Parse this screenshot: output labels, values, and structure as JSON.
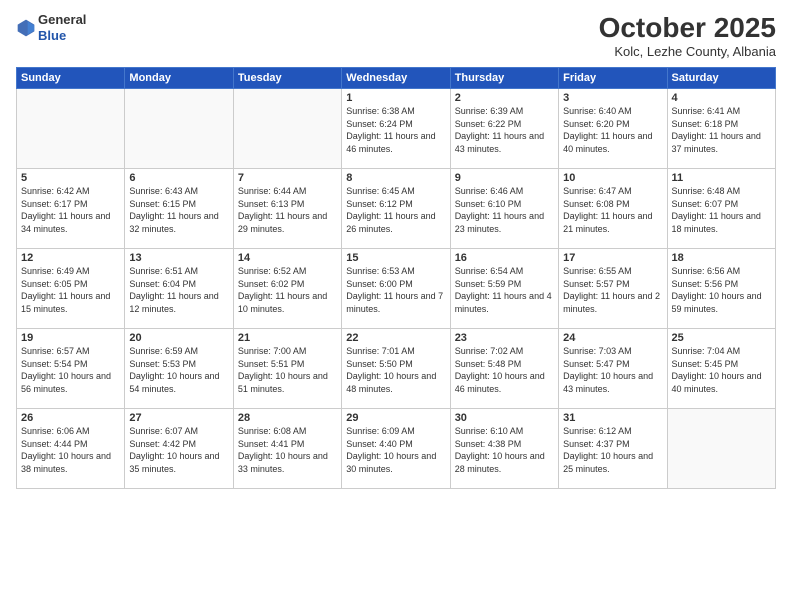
{
  "header": {
    "logo_line1": "General",
    "logo_line2": "Blue",
    "title": "October 2025",
    "subtitle": "Kolc, Lezhe County, Albania"
  },
  "days_of_week": [
    "Sunday",
    "Monday",
    "Tuesday",
    "Wednesday",
    "Thursday",
    "Friday",
    "Saturday"
  ],
  "weeks": [
    [
      {
        "day": "",
        "info": ""
      },
      {
        "day": "",
        "info": ""
      },
      {
        "day": "",
        "info": ""
      },
      {
        "day": "1",
        "info": "Sunrise: 6:38 AM\nSunset: 6:24 PM\nDaylight: 11 hours and 46 minutes."
      },
      {
        "day": "2",
        "info": "Sunrise: 6:39 AM\nSunset: 6:22 PM\nDaylight: 11 hours and 43 minutes."
      },
      {
        "day": "3",
        "info": "Sunrise: 6:40 AM\nSunset: 6:20 PM\nDaylight: 11 hours and 40 minutes."
      },
      {
        "day": "4",
        "info": "Sunrise: 6:41 AM\nSunset: 6:18 PM\nDaylight: 11 hours and 37 minutes."
      }
    ],
    [
      {
        "day": "5",
        "info": "Sunrise: 6:42 AM\nSunset: 6:17 PM\nDaylight: 11 hours and 34 minutes."
      },
      {
        "day": "6",
        "info": "Sunrise: 6:43 AM\nSunset: 6:15 PM\nDaylight: 11 hours and 32 minutes."
      },
      {
        "day": "7",
        "info": "Sunrise: 6:44 AM\nSunset: 6:13 PM\nDaylight: 11 hours and 29 minutes."
      },
      {
        "day": "8",
        "info": "Sunrise: 6:45 AM\nSunset: 6:12 PM\nDaylight: 11 hours and 26 minutes."
      },
      {
        "day": "9",
        "info": "Sunrise: 6:46 AM\nSunset: 6:10 PM\nDaylight: 11 hours and 23 minutes."
      },
      {
        "day": "10",
        "info": "Sunrise: 6:47 AM\nSunset: 6:08 PM\nDaylight: 11 hours and 21 minutes."
      },
      {
        "day": "11",
        "info": "Sunrise: 6:48 AM\nSunset: 6:07 PM\nDaylight: 11 hours and 18 minutes."
      }
    ],
    [
      {
        "day": "12",
        "info": "Sunrise: 6:49 AM\nSunset: 6:05 PM\nDaylight: 11 hours and 15 minutes."
      },
      {
        "day": "13",
        "info": "Sunrise: 6:51 AM\nSunset: 6:04 PM\nDaylight: 11 hours and 12 minutes."
      },
      {
        "day": "14",
        "info": "Sunrise: 6:52 AM\nSunset: 6:02 PM\nDaylight: 11 hours and 10 minutes."
      },
      {
        "day": "15",
        "info": "Sunrise: 6:53 AM\nSunset: 6:00 PM\nDaylight: 11 hours and 7 minutes."
      },
      {
        "day": "16",
        "info": "Sunrise: 6:54 AM\nSunset: 5:59 PM\nDaylight: 11 hours and 4 minutes."
      },
      {
        "day": "17",
        "info": "Sunrise: 6:55 AM\nSunset: 5:57 PM\nDaylight: 11 hours and 2 minutes."
      },
      {
        "day": "18",
        "info": "Sunrise: 6:56 AM\nSunset: 5:56 PM\nDaylight: 10 hours and 59 minutes."
      }
    ],
    [
      {
        "day": "19",
        "info": "Sunrise: 6:57 AM\nSunset: 5:54 PM\nDaylight: 10 hours and 56 minutes."
      },
      {
        "day": "20",
        "info": "Sunrise: 6:59 AM\nSunset: 5:53 PM\nDaylight: 10 hours and 54 minutes."
      },
      {
        "day": "21",
        "info": "Sunrise: 7:00 AM\nSunset: 5:51 PM\nDaylight: 10 hours and 51 minutes."
      },
      {
        "day": "22",
        "info": "Sunrise: 7:01 AM\nSunset: 5:50 PM\nDaylight: 10 hours and 48 minutes."
      },
      {
        "day": "23",
        "info": "Sunrise: 7:02 AM\nSunset: 5:48 PM\nDaylight: 10 hours and 46 minutes."
      },
      {
        "day": "24",
        "info": "Sunrise: 7:03 AM\nSunset: 5:47 PM\nDaylight: 10 hours and 43 minutes."
      },
      {
        "day": "25",
        "info": "Sunrise: 7:04 AM\nSunset: 5:45 PM\nDaylight: 10 hours and 40 minutes."
      }
    ],
    [
      {
        "day": "26",
        "info": "Sunrise: 6:06 AM\nSunset: 4:44 PM\nDaylight: 10 hours and 38 minutes."
      },
      {
        "day": "27",
        "info": "Sunrise: 6:07 AM\nSunset: 4:42 PM\nDaylight: 10 hours and 35 minutes."
      },
      {
        "day": "28",
        "info": "Sunrise: 6:08 AM\nSunset: 4:41 PM\nDaylight: 10 hours and 33 minutes."
      },
      {
        "day": "29",
        "info": "Sunrise: 6:09 AM\nSunset: 4:40 PM\nDaylight: 10 hours and 30 minutes."
      },
      {
        "day": "30",
        "info": "Sunrise: 6:10 AM\nSunset: 4:38 PM\nDaylight: 10 hours and 28 minutes."
      },
      {
        "day": "31",
        "info": "Sunrise: 6:12 AM\nSunset: 4:37 PM\nDaylight: 10 hours and 25 minutes."
      },
      {
        "day": "",
        "info": ""
      }
    ]
  ]
}
